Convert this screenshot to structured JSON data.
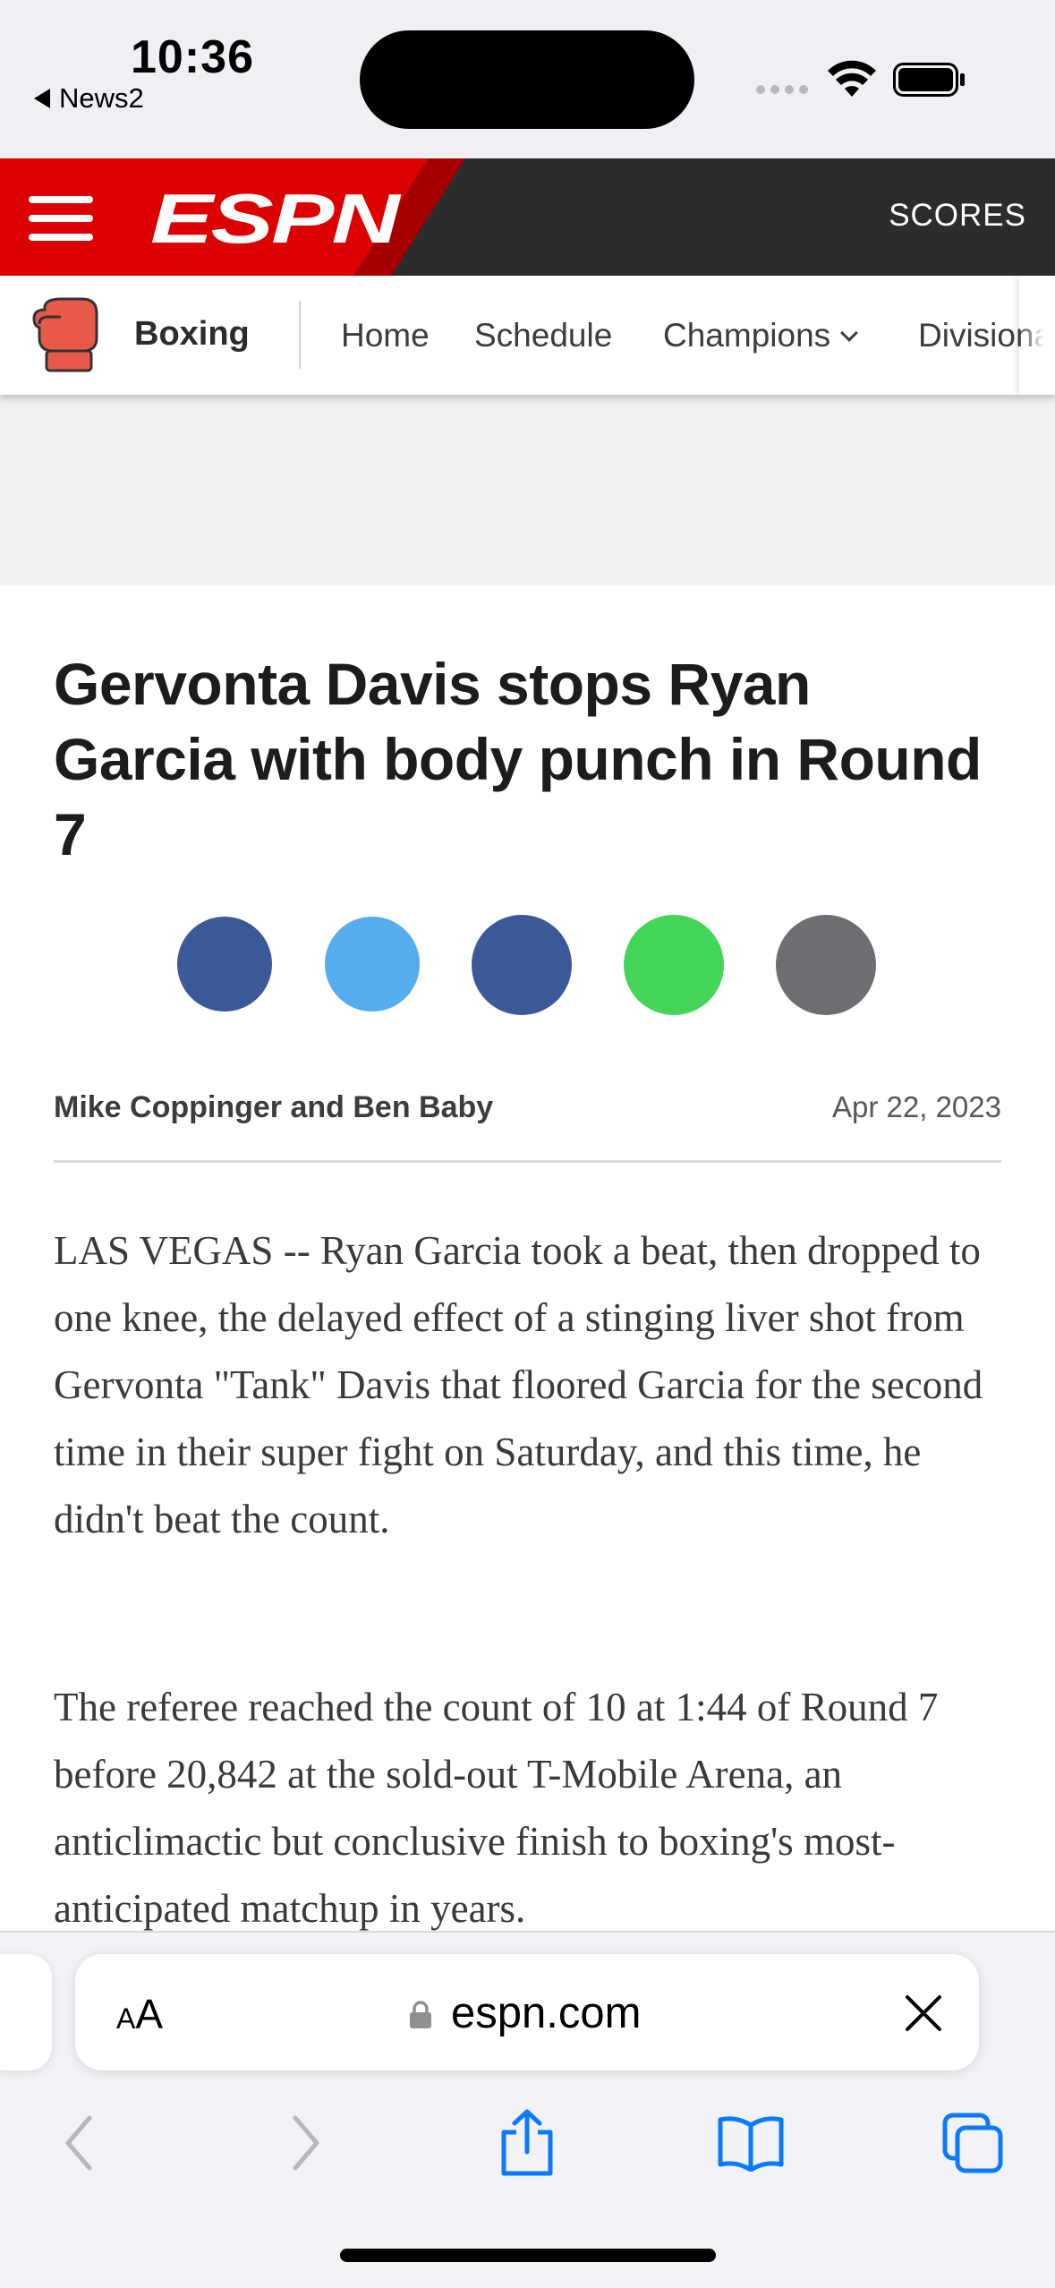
{
  "status_bar": {
    "time": "10:36",
    "back_app": "News2"
  },
  "espn_header": {
    "logo": "ESPN",
    "scores_label": "SCORES",
    "brand_red": "#dd0000",
    "bar_color": "#2b2c2d"
  },
  "subnav": {
    "sport_icon": "boxing-glove-icon",
    "sport_name": "Boxing",
    "links": [
      {
        "label": "Home"
      },
      {
        "label": "Schedule"
      },
      {
        "label": "Champions"
      },
      {
        "label": "Divisional"
      }
    ]
  },
  "article": {
    "headline": "Gervonta Davis stops Ryan Garcia with body punch in Round 7",
    "share_buttons": [
      {
        "name": "facebook-share",
        "color": "#3b5998"
      },
      {
        "name": "twitter-share",
        "color": "#55acee"
      },
      {
        "name": "messenger-share",
        "color": "#3b5998"
      },
      {
        "name": "message-share",
        "color": "#44d558"
      },
      {
        "name": "more-share",
        "color": "#6d6e71"
      }
    ],
    "authors": "Mike Coppinger and Ben Baby",
    "date": "Apr 22, 2023",
    "paragraphs": [
      "LAS VEGAS -- Ryan Garcia took a beat, then dropped to one knee, the delayed effect of a stinging liver shot from Gervonta \"Tank\" Davis that floored Garcia for the second time in their super fight on Saturday, and this time, he didn't beat the count.",
      "The referee reached the count of 10 at 1:44 of Round 7 before 20,842 at the sold-out T-Mobile Arena, an anticlimactic but conclusive finish to boxing's most-anticipated matchup in years."
    ]
  },
  "safari": {
    "text_size_small": "A",
    "text_size_large": "A",
    "url": "espn.com",
    "accent": "#0a7aff"
  }
}
